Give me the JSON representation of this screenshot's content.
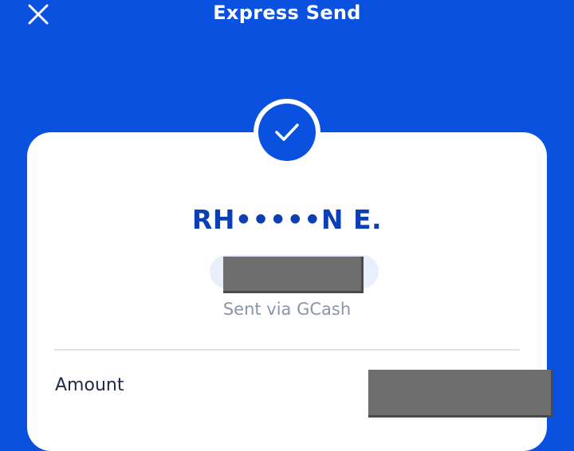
{
  "header": {
    "title": "Express Send",
    "close_icon": "close-icon"
  },
  "status": {
    "icon": "checkmark-icon"
  },
  "recipient": {
    "name": "RH•••••N E.",
    "sent_via": "Sent via GCash"
  },
  "details": {
    "amount_label": "Amount"
  },
  "colors": {
    "brand_blue": "#0b51e0",
    "name_blue": "#0b3fb5",
    "muted_text": "#8a95a8",
    "redaction_gray": "#6e6e6e"
  }
}
